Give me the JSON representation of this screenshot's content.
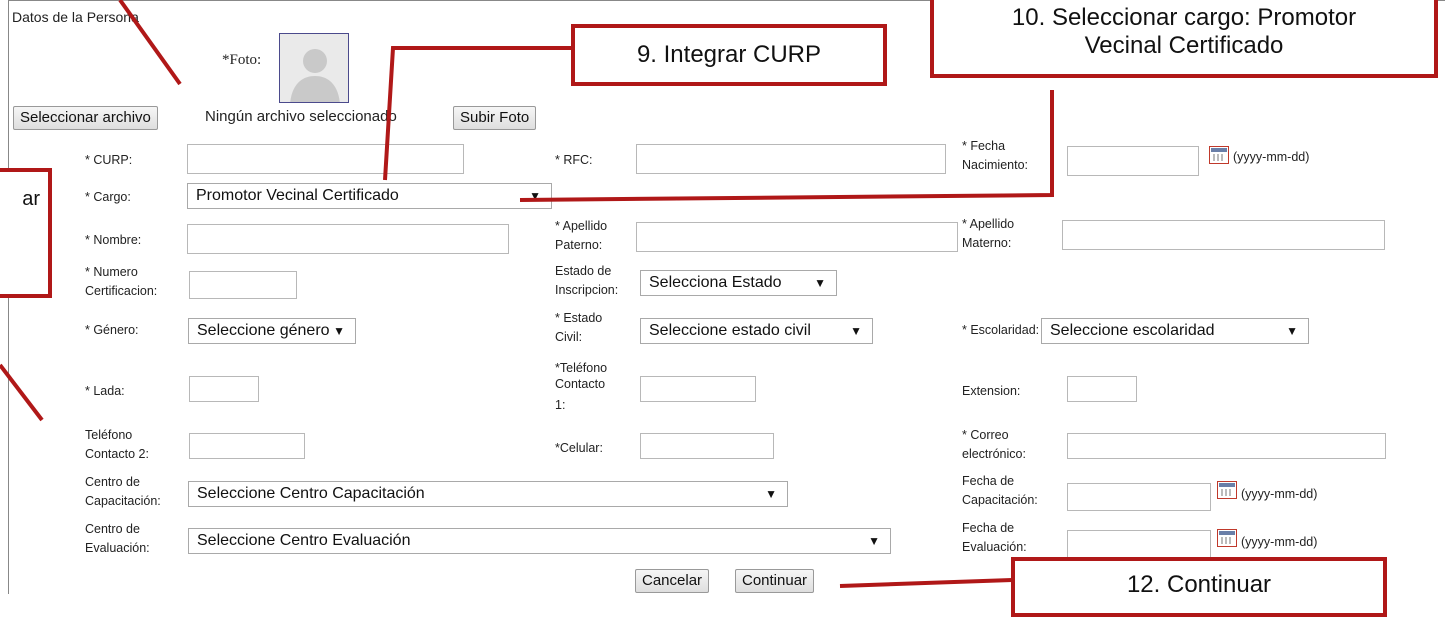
{
  "section_title": "Datos de la Persona",
  "photo": {
    "label": "*Foto:"
  },
  "file": {
    "select_button": "Seleccionar archivo",
    "status": "Ningún archivo seleccionado",
    "upload_button": "Subir Foto"
  },
  "fields": {
    "curp": "* CURP:",
    "rfc": "* RFC:",
    "fecha_nac_1": "* Fecha",
    "fecha_nac_2": "Nacimiento:",
    "cargo": "* Cargo:",
    "cargo_value": "Promotor Vecinal Certificado",
    "nombre": "* Nombre:",
    "ap_paterno_1": "* Apellido",
    "ap_paterno_2": "Paterno:",
    "ap_materno_1": "* Apellido",
    "ap_materno_2": "Materno:",
    "num_cert_1": "* Numero",
    "num_cert_2": "Certificacion:",
    "estado_insc_1": "Estado de",
    "estado_insc_2": "Inscripcion:",
    "estado_insc_value": "Selecciona Estado",
    "genero": "* Género:",
    "genero_value": "Seleccione género",
    "estado_civil_1": "* Estado",
    "estado_civil_2": "Civil:",
    "estado_civil_value": "Seleccione estado civil",
    "escolaridad": "* Escolaridad:",
    "escolaridad_value": "Seleccione escolaridad",
    "lada": "* Lada:",
    "tel1_1": "*Teléfono",
    "tel1_2": "Contacto",
    "tel1_3": "1:",
    "extension": "Extension:",
    "tel2_1": "Teléfono",
    "tel2_2": "Contacto 2:",
    "celular": "*Celular:",
    "correo_1": "* Correo",
    "correo_2": "electrónico:",
    "centro_cap_1": "Centro de",
    "centro_cap_2": "Capacitación:",
    "centro_cap_value": "Seleccione Centro Capacitación",
    "fecha_cap_1": "Fecha de",
    "fecha_cap_2": "Capacitación:",
    "centro_eval_1": "Centro de",
    "centro_eval_2": "Evaluación:",
    "centro_eval_value": "Seleccione Centro Evaluación",
    "fecha_eval_1": "Fecha de",
    "fecha_eval_2": "Evaluación:",
    "date_format": "(yyyy-mm-dd)"
  },
  "buttons": {
    "cancel": "Cancelar",
    "continue": "Continuar"
  },
  "callouts": {
    "c9": "9. Integrar CURP",
    "c10_1": "10. Seleccionar cargo: Promotor",
    "c10_2": "Vecinal Certificado",
    "c11_partial": "ar",
    "c12": "12. Continuar"
  },
  "colors": {
    "callout_border": "#b01818",
    "arrow": "#b01818"
  }
}
